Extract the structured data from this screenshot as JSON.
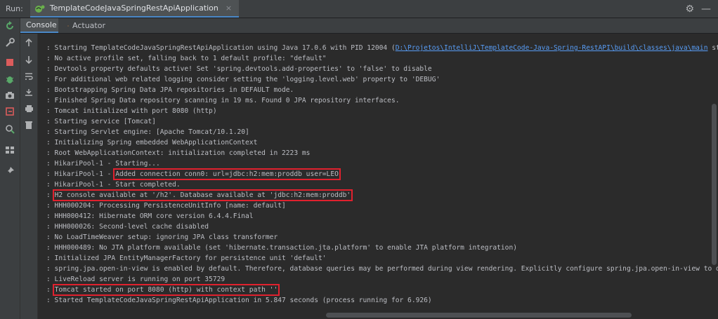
{
  "run_label": "Run:",
  "tab_title": "TemplateCodeJavaSpringRestApiApplication",
  "tab_close": "×",
  "header_icons": {
    "settings": "⚙",
    "minimize": "—"
  },
  "sub_tabs": [
    {
      "label": "Console",
      "icon": "console-icon"
    },
    {
      "label": "Actuator",
      "icon": "actuator-icon"
    }
  ],
  "left_toolbar_icons": [
    "rerun",
    "modify",
    "stop",
    "debug",
    "dump-threads",
    "camera",
    "exit",
    "settings-search",
    "layout",
    "pin"
  ],
  "console_toolbar_icons": [
    "up",
    "down",
    "soft-wrap",
    "scroll-to-end",
    "print",
    "clear"
  ],
  "colors": {
    "highlight": "#e0212e",
    "link": "#589df6",
    "accent": "#4a88c7"
  },
  "log": [
    {
      "prefix": ": Starting TemplateCodeJavaSpringRestApiApplication using Java 17.0.6 with PID 12004 (",
      "link": "D:\\Projetos\\IntelliJ\\TemplateCode-Java-Spring-RestAPI\\build\\classes\\java\\main",
      "suffix": " started b"
    },
    {
      "text": ": No active profile set, falling back to 1 default profile: \"default\""
    },
    {
      "text": ": Devtools property defaults active! Set 'spring.devtools.add-properties' to 'false' to disable"
    },
    {
      "text": ": For additional web related logging consider setting the 'logging.level.web' property to 'DEBUG'"
    },
    {
      "text": ": Bootstrapping Spring Data JPA repositories in DEFAULT mode."
    },
    {
      "text": ": Finished Spring Data repository scanning in 19 ms. Found 0 JPA repository interfaces."
    },
    {
      "text": ": Tomcat initialized with port 8080 (http)"
    },
    {
      "text": ": Starting service [Tomcat]"
    },
    {
      "text": ": Starting Servlet engine: [Apache Tomcat/10.1.20]"
    },
    {
      "text": ": Initializing Spring embedded WebApplicationContext"
    },
    {
      "text": ": Root WebApplicationContext: initialization completed in 2223 ms"
    },
    {
      "text": ": HikariPool-1 - Starting..."
    },
    {
      "prefix": ": HikariPool-1 - ",
      "hl": "Added connection conn0: url=jdbc:h2:mem:proddb user=LEO"
    },
    {
      "text": ": HikariPool-1 - Start completed."
    },
    {
      "prefix": ": ",
      "hl": "H2 console available at '/h2'. Database available at 'jdbc:h2:mem:proddb'"
    },
    {
      "text": ": HHH000204: Processing PersistenceUnitInfo [name: default]"
    },
    {
      "text": ": HHH000412: Hibernate ORM core version 6.4.4.Final"
    },
    {
      "text": ": HHH000026: Second-level cache disabled"
    },
    {
      "text": ": No LoadTimeWeaver setup: ignoring JPA class transformer"
    },
    {
      "text": ": HHH000489: No JTA platform available (set 'hibernate.transaction.jta.platform' to enable JTA platform integration)"
    },
    {
      "text": ": Initialized JPA EntityManagerFactory for persistence unit 'default'"
    },
    {
      "text": ": spring.jpa.open-in-view is enabled by default. Therefore, database queries may be performed during view rendering. Explicitly configure spring.jpa.open-in-view to disable"
    },
    {
      "text": ": LiveReload server is running on port 35729"
    },
    {
      "prefix": ": ",
      "hl": "Tomcat started on port 8080 (http) with context path ''"
    },
    {
      "text": ": Started TemplateCodeJavaSpringRestApiApplication in 5.847 seconds (process running for 6.926)"
    }
  ]
}
